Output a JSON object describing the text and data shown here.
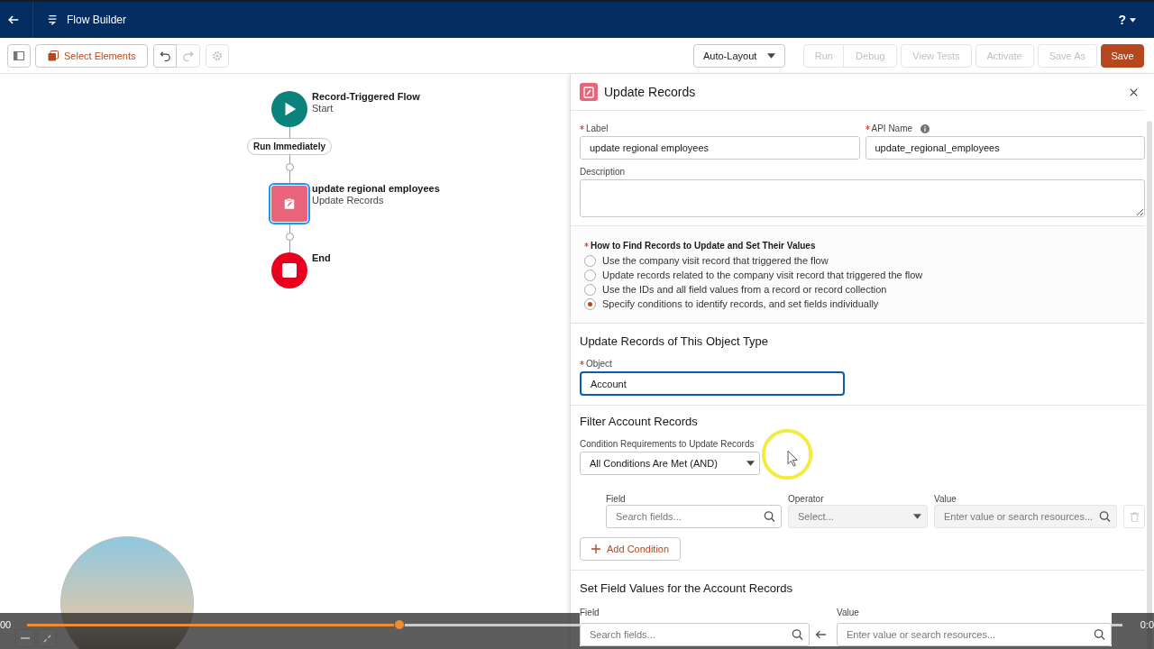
{
  "header": {
    "title": "Flow Builder",
    "help": "?"
  },
  "toolbar": {
    "select_button": "Select Elements",
    "layout_menu": "Auto-Layout",
    "actions": [
      {
        "label": "Run",
        "disabled": true,
        "kind": "grouped"
      },
      {
        "label": "Debug",
        "disabled": true,
        "kind": "grouped"
      },
      {
        "label": "View Tests",
        "disabled": true,
        "kind": "neutral"
      },
      {
        "label": "Activate",
        "disabled": true,
        "kind": "neutral"
      },
      {
        "label": "Save As",
        "disabled": true,
        "kind": "neutral"
      },
      {
        "label": "Save",
        "disabled": false,
        "kind": "brand"
      }
    ]
  },
  "canvas": {
    "nodes": [
      {
        "kind": "start",
        "title": "Record-Triggered Flow",
        "subtitle": "Start",
        "selected": false
      },
      {
        "kind": "path",
        "title": "Run Immediately",
        "selected": false
      },
      {
        "kind": "action",
        "title": "update regional employees",
        "subtitle": "Update Records",
        "selected": true
      },
      {
        "kind": "end",
        "title": "End",
        "selected": false
      }
    ]
  },
  "panel": {
    "title": "Update Records",
    "label_field": {
      "label": "Label",
      "required": true,
      "value": "update regional employees"
    },
    "api_name_field": {
      "label": "API Name",
      "required": true,
      "value": "update_regional_employees"
    },
    "description_field": {
      "label": "Description"
    },
    "how_to_find": {
      "label": "How to Find Records to Update and Set Their Values",
      "required": true,
      "options": [
        {
          "label": "Use the company visit record that triggered the flow",
          "selected": false
        },
        {
          "label": "Update records related to the company visit record that triggered the flow",
          "selected": false
        },
        {
          "label": "Use the IDs and all field values from a record or record collection",
          "selected": false
        },
        {
          "label": "Specify conditions to identify records, and set fields individually",
          "selected": true
        }
      ]
    },
    "object_section": {
      "heading": "Update Records of This Object Type",
      "field": {
        "label": "Object",
        "required": true,
        "value": "Account",
        "focused": true
      }
    },
    "filter_section": {
      "heading": "Filter Account Records",
      "condition_label": "Condition Requirements to Update Records",
      "condition_value": "All Conditions Are Met (AND)",
      "columns": [
        "Field",
        "Operator",
        "Value"
      ],
      "field_placeholder": "Search fields...",
      "operator_placeholder": "Select...",
      "value_placeholder": "Enter value or search resources...",
      "add_button": "Add Condition"
    },
    "set_section": {
      "heading": "Set Field Values for the Account Records",
      "columns": [
        "Field",
        "Value"
      ],
      "field_placeholder": "Search fields...",
      "value_placeholder": "Enter value or search resources..."
    }
  },
  "video": {
    "elapsed": "00",
    "duration": "0:0",
    "level": 0.34
  }
}
